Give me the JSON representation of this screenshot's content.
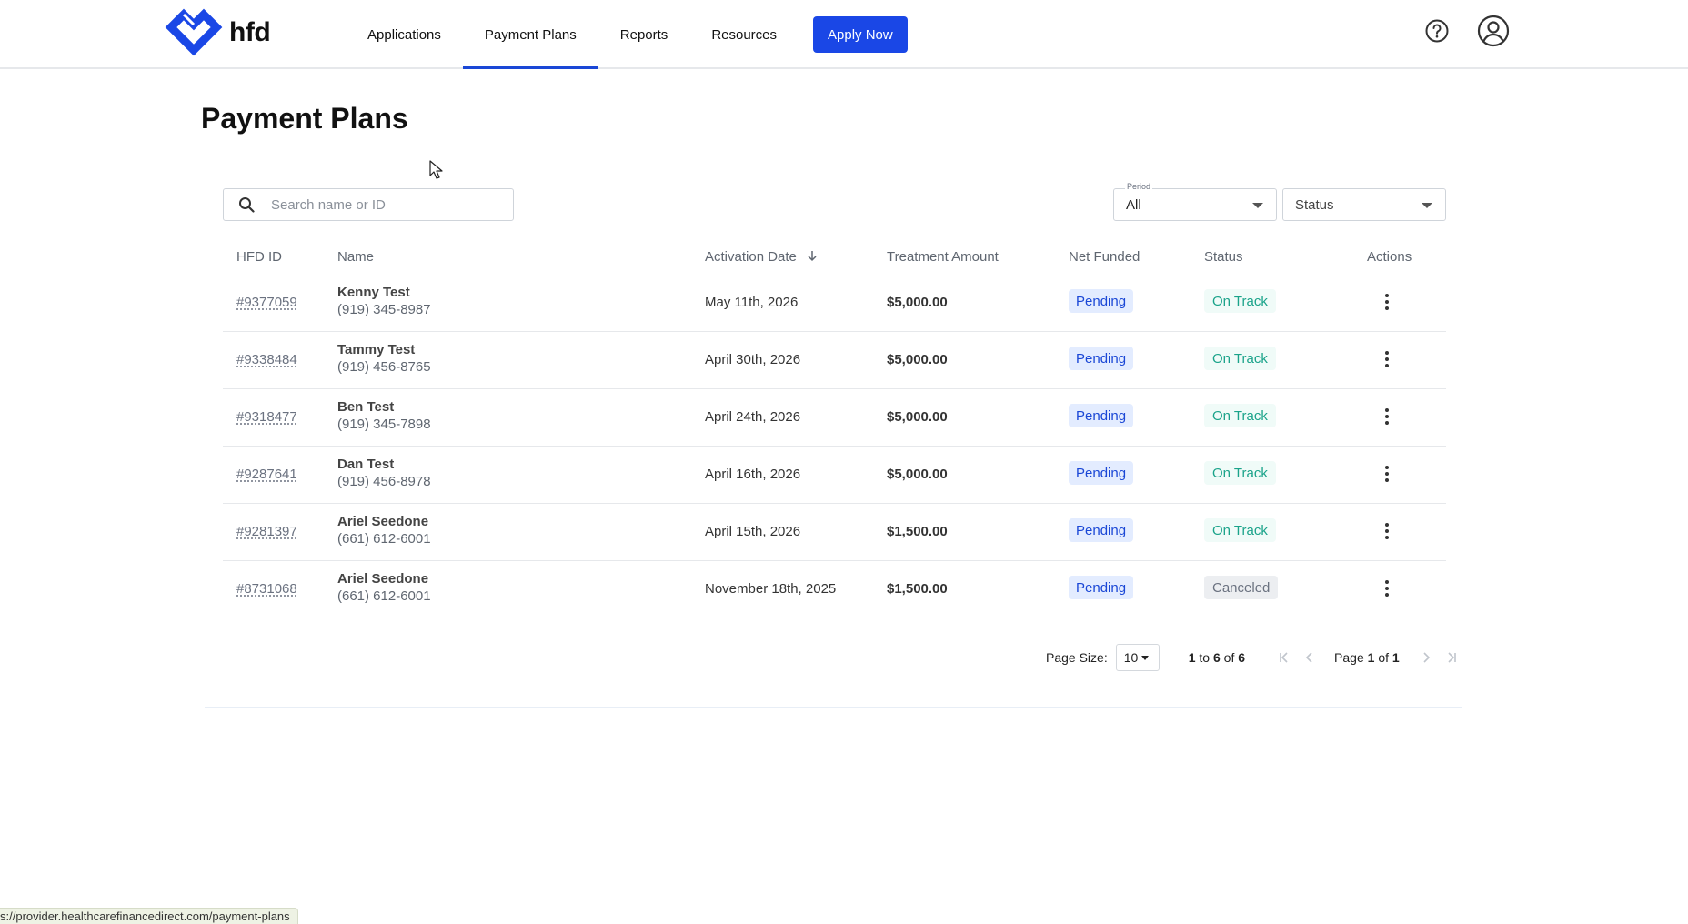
{
  "header": {
    "logo_text": "hfd",
    "nav": [
      {
        "label": "Applications",
        "active": false
      },
      {
        "label": "Payment Plans",
        "active": true
      },
      {
        "label": "Reports",
        "active": false
      },
      {
        "label": "Resources",
        "active": false
      }
    ],
    "apply_label": "Apply Now",
    "accent_color": "#1a47e6",
    "icons": [
      "help-circle-icon",
      "user-circle-icon"
    ]
  },
  "page": {
    "title": "Payment Plans"
  },
  "filters": {
    "search_placeholder": "Search name or ID",
    "period_label": "Period",
    "period_value": "All",
    "status_placeholder": "Status"
  },
  "table": {
    "columns": [
      "HFD ID",
      "Name",
      "Activation Date",
      "Treatment Amount",
      "Net Funded",
      "Status",
      "Actions"
    ],
    "sorted_column": "Activation Date",
    "sort_direction": "descending",
    "rows": [
      {
        "id": "#9377059",
        "name": "Kenny Test",
        "phone": "(919) 345-8987",
        "date": "May 11th, 2026",
        "amount": "$5,000.00",
        "net_funded": "Pending",
        "status": "On Track"
      },
      {
        "id": "#9338484",
        "name": "Tammy Test",
        "phone": "(919) 456-8765",
        "date": "April 30th, 2026",
        "amount": "$5,000.00",
        "net_funded": "Pending",
        "status": "On Track"
      },
      {
        "id": "#9318477",
        "name": "Ben Test",
        "phone": "(919) 345-7898",
        "date": "April 24th, 2026",
        "amount": "$5,000.00",
        "net_funded": "Pending",
        "status": "On Track"
      },
      {
        "id": "#9287641",
        "name": "Dan Test",
        "phone": "(919) 456-8978",
        "date": "April 16th, 2026",
        "amount": "$5,000.00",
        "net_funded": "Pending",
        "status": "On Track"
      },
      {
        "id": "#9281397",
        "name": "Ariel Seedone",
        "phone": "(661) 612-6001",
        "date": "April 15th, 2026",
        "amount": "$1,500.00",
        "net_funded": "Pending",
        "status": "On Track"
      },
      {
        "id": "#8731068",
        "name": "Ariel Seedone",
        "phone": "(661) 612-6001",
        "date": "November 18th, 2025",
        "amount": "$1,500.00",
        "net_funded": "Pending",
        "status": "Canceled"
      }
    ]
  },
  "pagination": {
    "page_size_label": "Page Size:",
    "page_size": "10",
    "range_from": "1",
    "range_to_word": "to",
    "range_to": "6",
    "range_of_word": "of",
    "range_total": "6",
    "page_word": "Page",
    "page_current": "1",
    "page_of_word": "of",
    "page_total": "1"
  },
  "statusbar": {
    "url": "s://provider.healthcarefinancedirect.com/payment-plans"
  }
}
